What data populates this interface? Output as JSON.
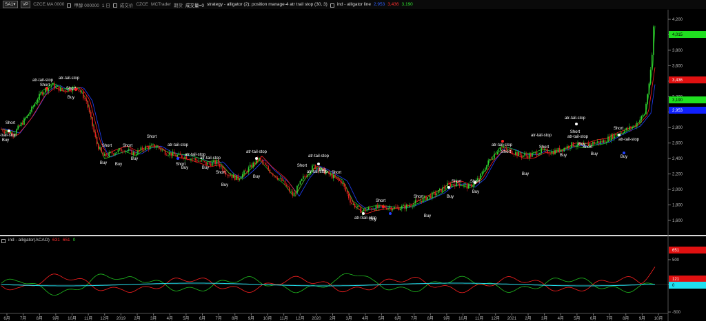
{
  "toolbar": {
    "sa_button": "SA1▾",
    "vp_button": "VP",
    "symbol": "CZCE.MA 0000",
    "name": "甲醇 000000",
    "period": "1 日",
    "vol_label": "成交价",
    "exchange": "CZCE",
    "source": "MCTrader",
    "contract": "期货",
    "vol_zero": "成交量=0",
    "strategy": "strategy - alligator (2); position manage-4 atr trail stop (30, 3)",
    "indicator": "ind - alligator line",
    "ind_v1": "2,953",
    "ind_v2": "3,436",
    "ind_v3": "3,190"
  },
  "price_axis": [
    "4,200",
    "4,000",
    "3,800",
    "3,600",
    "3,400",
    "3,200",
    "3,000",
    "2,800",
    "2,600",
    "2,400",
    "2,200",
    "2,000",
    "1,800",
    "1,600"
  ],
  "price_tags": {
    "green_top": "4,015",
    "red": "3,436",
    "green_mid": "3,190",
    "blue": "2,953"
  },
  "indicator_panel": {
    "title": "ind - alligator(ACAO)",
    "v1": "631",
    "v2": "651",
    "v3": "0",
    "axis": [
      "500",
      "0",
      "-500"
    ],
    "tags": {
      "red_top": "651",
      "red_low": "121",
      "cyan": "0"
    }
  },
  "time_axis": [
    "6月",
    "7月",
    "8月",
    "9月",
    "10月",
    "11月",
    "12月",
    "2019",
    "2月",
    "3月",
    "4月",
    "5月",
    "6月",
    "7月",
    "8月",
    "9月",
    "10月",
    "11月",
    "12月",
    "2020",
    "2月",
    "3月",
    "4月",
    "5月",
    "6月",
    "7月",
    "8月",
    "9月",
    "10月",
    "11月",
    "12月",
    "2021",
    "2月",
    "3月",
    "4月",
    "5月",
    "6月",
    "7月",
    "8月",
    "9月",
    "10月"
  ],
  "signals": [
    {
      "t": "atr-trail-stop"
    },
    {
      "t": "Short"
    },
    {
      "t": "Buy"
    },
    {
      "t": "atr-tail-stop"
    },
    {
      "t": "Short"
    },
    {
      "t": "atr-tail-stop"
    },
    {
      "t": "Short"
    },
    {
      "t": "Buy"
    },
    {
      "t": "Short"
    },
    {
      "t": "Buy"
    },
    {
      "t": "Short"
    },
    {
      "t": "Buy"
    },
    {
      "t": "Short"
    },
    {
      "t": "Buy"
    },
    {
      "t": "atr-tail-stop"
    },
    {
      "t": "Short"
    },
    {
      "t": "Buy"
    },
    {
      "t": "atr-tail-stop"
    },
    {
      "t": "Buy"
    },
    {
      "t": "atr-tail-stop"
    },
    {
      "t": "Short"
    },
    {
      "t": "Buy"
    },
    {
      "t": "atr-tail-stop"
    },
    {
      "t": "Buy"
    },
    {
      "t": "atr-tail-stop"
    },
    {
      "t": "Short"
    },
    {
      "t": "Buy"
    },
    {
      "t": "atr-tail-stop"
    },
    {
      "t": "Short"
    },
    {
      "t": "Buy"
    },
    {
      "t": "Short"
    },
    {
      "t": "Short"
    },
    {
      "t": "atr-trail-stop"
    },
    {
      "t": "Buy"
    },
    {
      "t": "Short"
    },
    {
      "t": "Buy"
    },
    {
      "t": "Short"
    },
    {
      "t": "Buy"
    },
    {
      "t": "atr-tail-stop"
    },
    {
      "t": "Short"
    },
    {
      "t": "Buy"
    },
    {
      "t": "atr-tail-stop"
    },
    {
      "t": "Short"
    },
    {
      "t": "Buy"
    },
    {
      "t": "atr-tail-stop"
    },
    {
      "t": "Short"
    },
    {
      "t": "Buy"
    },
    {
      "t": "atr-tail-stop"
    },
    {
      "t": "Short"
    },
    {
      "t": "Buy"
    },
    {
      "t": "Short"
    },
    {
      "t": "atr-tail-stop"
    },
    {
      "t": "Buy"
    }
  ],
  "colors": {
    "bull": "#30d030",
    "bear": "#e02020",
    "jaw": "#2040ff",
    "teeth": "#ff2020",
    "lips": "#20c020",
    "cyan": "#20e0f0"
  }
}
